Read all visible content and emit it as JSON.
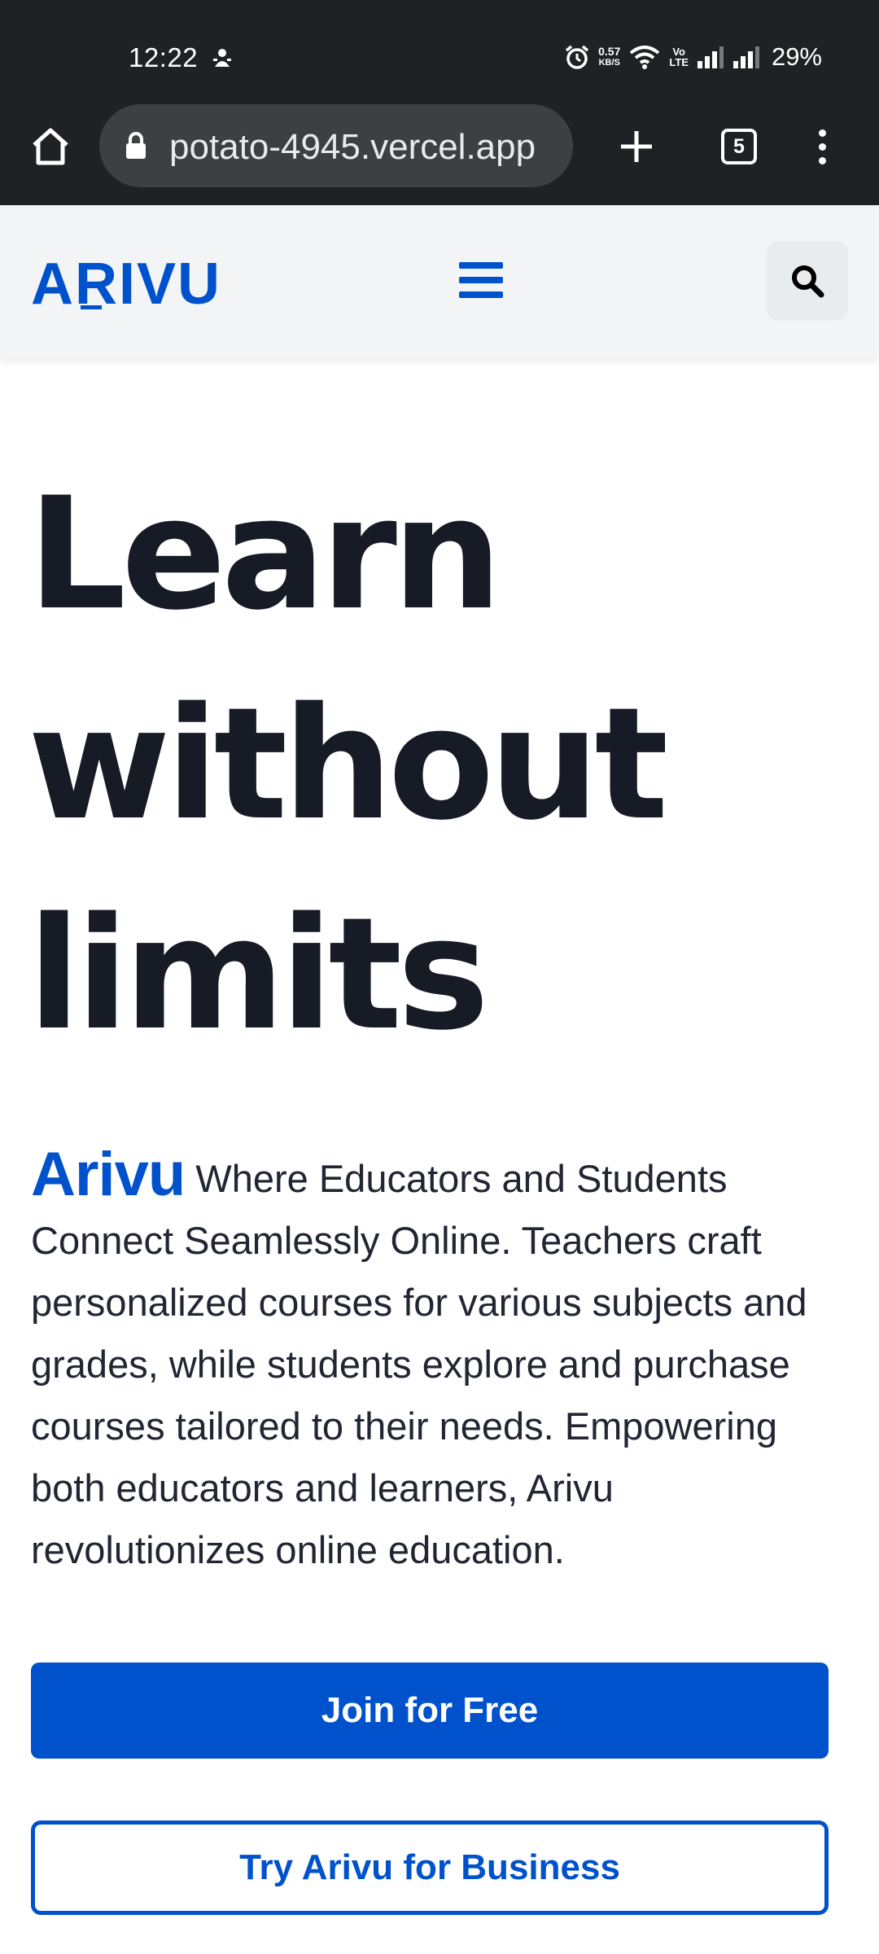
{
  "status_bar": {
    "time": "12:22",
    "net_speed_value": "0.57",
    "net_speed_unit": "KB/S",
    "volte_top": "Vo",
    "volte_bottom": "LTE",
    "battery": "29%"
  },
  "browser": {
    "url": "potato-4945.vercel.app",
    "tab_count": "5"
  },
  "header": {
    "logo": "ARIVU"
  },
  "hero": {
    "title_line1": "Learn",
    "title_line2": "without",
    "title_line3": "limits",
    "brand": "Arivu",
    "description": " Where Educators and Students Connect Seamlessly Online. Teachers craft personalized courses for various subjects and grades, while students explore and purchase courses tailored to their needs. Empowering both educators and learners, Arivu revolutionizes online education."
  },
  "buttons": {
    "join": "Join for Free",
    "business": "Try Arivu for Business"
  },
  "colors": {
    "brand": "#0052cc",
    "chrome_bg": "#202124",
    "header_bg": "#f3f4f6",
    "text_dark": "#161b26"
  }
}
